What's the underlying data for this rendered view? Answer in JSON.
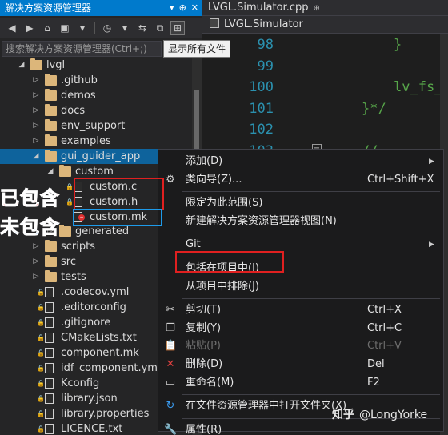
{
  "explorer": {
    "title": "解决方案资源管理器",
    "title_buttons": [
      "▾",
      "⊕",
      "✕"
    ],
    "search_placeholder": "搜索解决方案资源管理器(Ctrl+;)",
    "tooltip": "显示所有文件",
    "tree": [
      {
        "label": "lvgl",
        "type": "folder",
        "depth": 0,
        "expander": "open"
      },
      {
        "label": ".github",
        "type": "folder",
        "depth": 1,
        "expander": "closed"
      },
      {
        "label": "demos",
        "type": "folder",
        "depth": 1,
        "expander": "closed"
      },
      {
        "label": "docs",
        "type": "folder",
        "depth": 1,
        "expander": "closed"
      },
      {
        "label": "env_support",
        "type": "folder",
        "depth": 1,
        "expander": "closed"
      },
      {
        "label": "examples",
        "type": "folder",
        "depth": 1,
        "expander": "closed"
      },
      {
        "label": "gui_guider_app",
        "type": "folder",
        "depth": 1,
        "expander": "open",
        "selected": true
      },
      {
        "label": "custom",
        "type": "folder",
        "depth": 2,
        "expander": "open"
      },
      {
        "label": "custom.c",
        "type": "file",
        "depth": 3,
        "lock": true
      },
      {
        "label": "custom.h",
        "type": "file",
        "depth": 3,
        "lock": true
      },
      {
        "label": "custom.mk",
        "type": "file",
        "depth": 3,
        "excluded": true
      },
      {
        "label": "generated",
        "type": "folder",
        "depth": 2,
        "expander": "closed"
      },
      {
        "label": "scripts",
        "type": "folder",
        "depth": 1,
        "expander": "closed"
      },
      {
        "label": "src",
        "type": "folder",
        "depth": 1,
        "expander": "closed"
      },
      {
        "label": "tests",
        "type": "folder",
        "depth": 1,
        "expander": "closed"
      },
      {
        "label": ".codecov.yml",
        "type": "file",
        "depth": 1,
        "lock": true
      },
      {
        "label": ".editorconfig",
        "type": "file",
        "depth": 1,
        "lock": true
      },
      {
        "label": ".gitignore",
        "type": "file",
        "depth": 1,
        "lock": true
      },
      {
        "label": "CMakeLists.txt",
        "type": "file",
        "depth": 1,
        "lock": true
      },
      {
        "label": "component.mk",
        "type": "file",
        "depth": 1,
        "lock": true
      },
      {
        "label": "idf_component.yml",
        "type": "file",
        "depth": 1,
        "lock": true
      },
      {
        "label": "Kconfig",
        "type": "file",
        "depth": 1,
        "lock": true
      },
      {
        "label": "library.json",
        "type": "file",
        "depth": 1,
        "lock": true
      },
      {
        "label": "library.properties",
        "type": "file",
        "depth": 1,
        "lock": true
      },
      {
        "label": "LICENCE.txt",
        "type": "file",
        "depth": 1,
        "lock": true
      }
    ]
  },
  "editor": {
    "tab_label": "LVGL.Simulator.cpp",
    "tab_pin": "⊕",
    "scope_label": "LVGL.Simulator",
    "lines": [
      {
        "num": "98",
        "code": "}"
      },
      {
        "num": "99",
        "code": ""
      },
      {
        "num": "100",
        "code": "lv_fs_c"
      },
      {
        "num": "101",
        "code": "}*/"
      },
      {
        "num": "102",
        "code": ""
      },
      {
        "num": "103",
        "code": "// ------"
      }
    ],
    "fold_glyph": "−"
  },
  "context_menu": {
    "items": [
      {
        "label": "添加(D)",
        "arrow": "▶"
      },
      {
        "label": "类向导(Z)...",
        "shortcut": "Ctrl+Shift+X",
        "icon": "wizard-icon"
      },
      {
        "sep": true
      },
      {
        "label": "限定为此范围(S)"
      },
      {
        "label": "新建解决方案资源管理器视图(N)"
      },
      {
        "sep": true
      },
      {
        "label": "Git",
        "arrow": "▶"
      },
      {
        "sep": true
      },
      {
        "label": "包括在项目中(J)"
      },
      {
        "label": "从项目中排除(J)"
      },
      {
        "sep": true
      },
      {
        "label": "剪切(T)",
        "shortcut": "Ctrl+X",
        "icon": "cut-icon"
      },
      {
        "label": "复制(Y)",
        "shortcut": "Ctrl+C",
        "icon": "copy-icon"
      },
      {
        "label": "粘贴(P)",
        "shortcut": "Ctrl+V",
        "icon": "paste-icon",
        "disabled": true
      },
      {
        "label": "删除(D)",
        "shortcut": "Del",
        "icon": "delete-icon"
      },
      {
        "label": "重命名(M)",
        "shortcut": "F2",
        "icon": "rename-icon"
      },
      {
        "sep": true
      },
      {
        "label": "在文件资源管理器中打开文件夹(X)",
        "icon": "refresh-icon"
      },
      {
        "sep": true
      },
      {
        "label": "属性(R)",
        "icon": "wrench-icon"
      }
    ]
  },
  "annotations": {
    "included": "已包含",
    "excluded": "未包含"
  },
  "watermark": {
    "site": "知乎",
    "author": "@LongYorke"
  },
  "colors": {
    "accent": "#007acc",
    "selection": "#0e639c",
    "annotation_red": "#e02020",
    "annotation_blue": "#1e9bea"
  }
}
